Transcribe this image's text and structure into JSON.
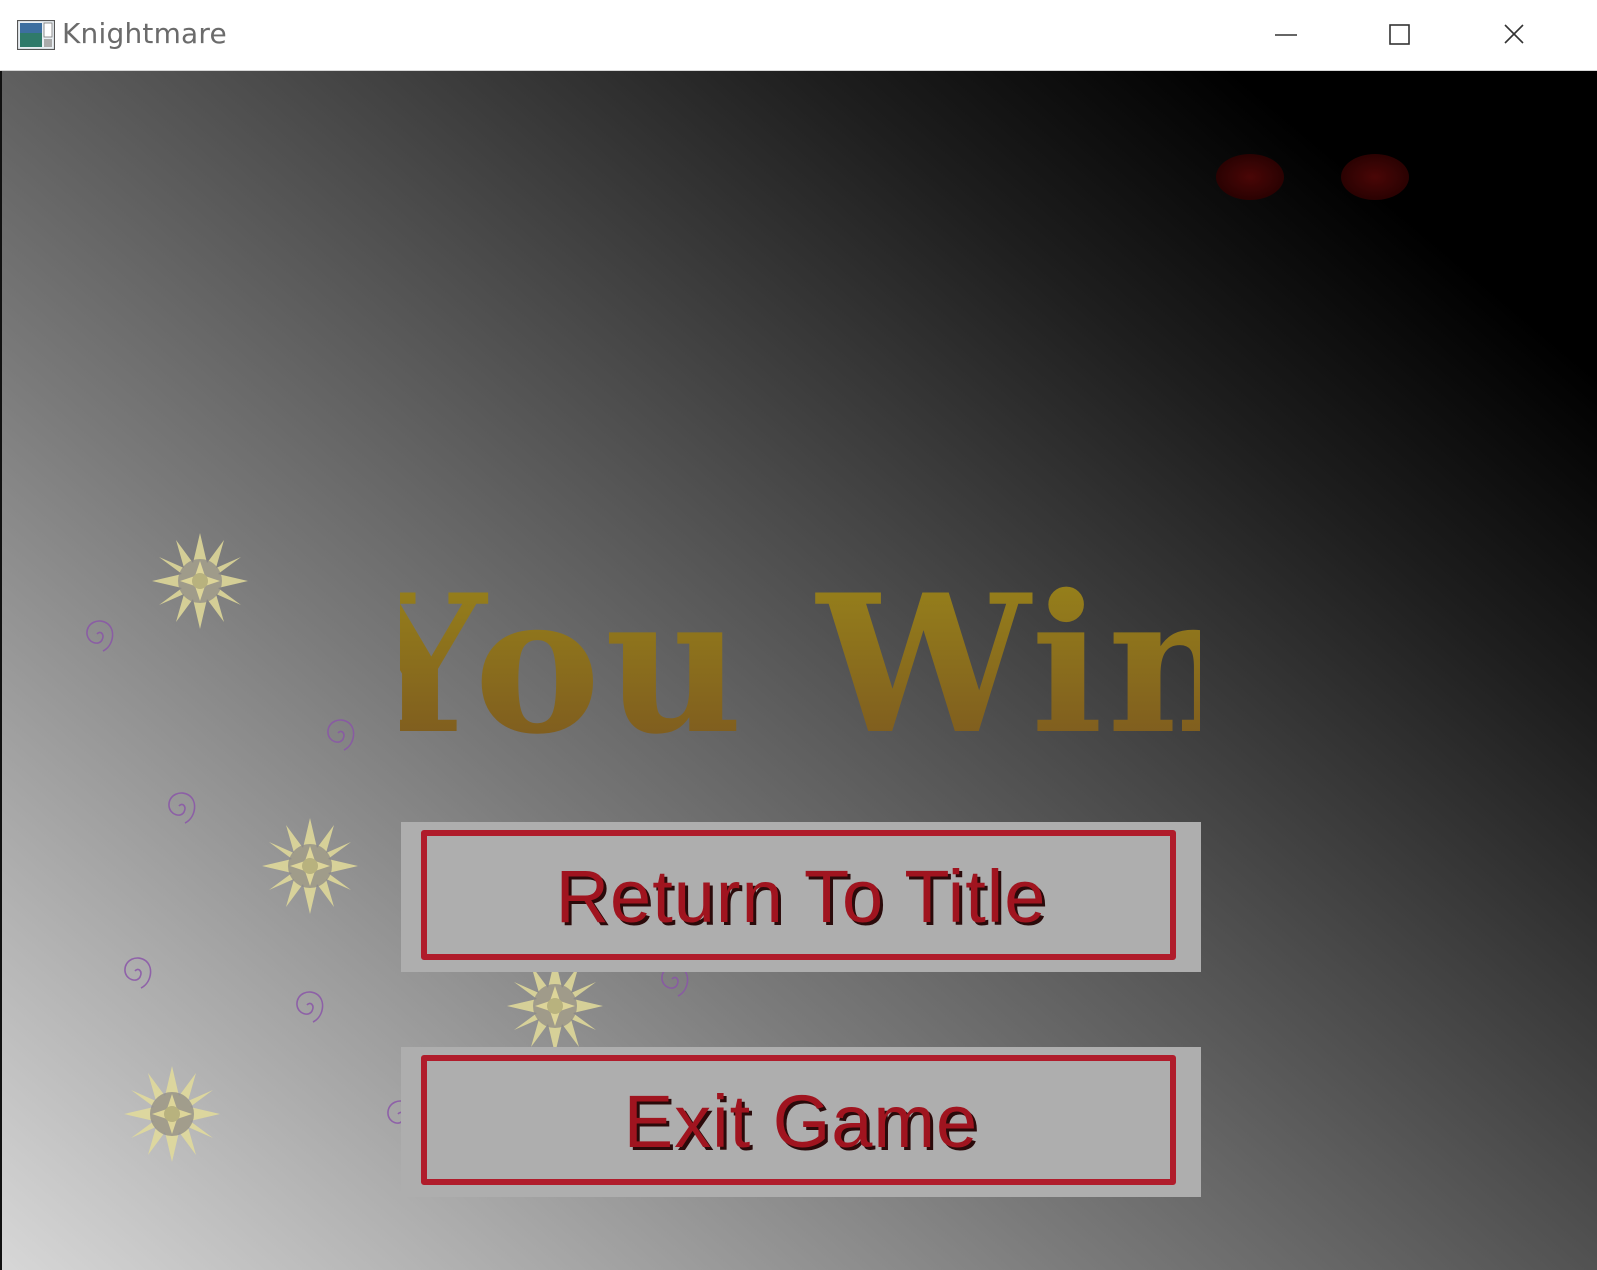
{
  "window": {
    "title": "Knightmare",
    "controls": {
      "minimize": "minimize-icon",
      "maximize": "maximize-icon",
      "close": "close-icon"
    }
  },
  "game": {
    "headline": "You Win",
    "buttons": {
      "return_label": "Return To Title",
      "exit_label": "Exit Game"
    },
    "colors": {
      "headline_top": "#9a861a",
      "headline_bottom": "#7a5520",
      "button_text": "#a0141f",
      "button_frame": "#b01c2b",
      "button_fill": "#aeaeae",
      "eyes": "#3a0404",
      "sunburst": "#e3dc9a",
      "spiral": "#8a55a8"
    },
    "decorations": {
      "sunburst_count": 4,
      "spiral_count": 7,
      "eyes_count": 2
    }
  }
}
